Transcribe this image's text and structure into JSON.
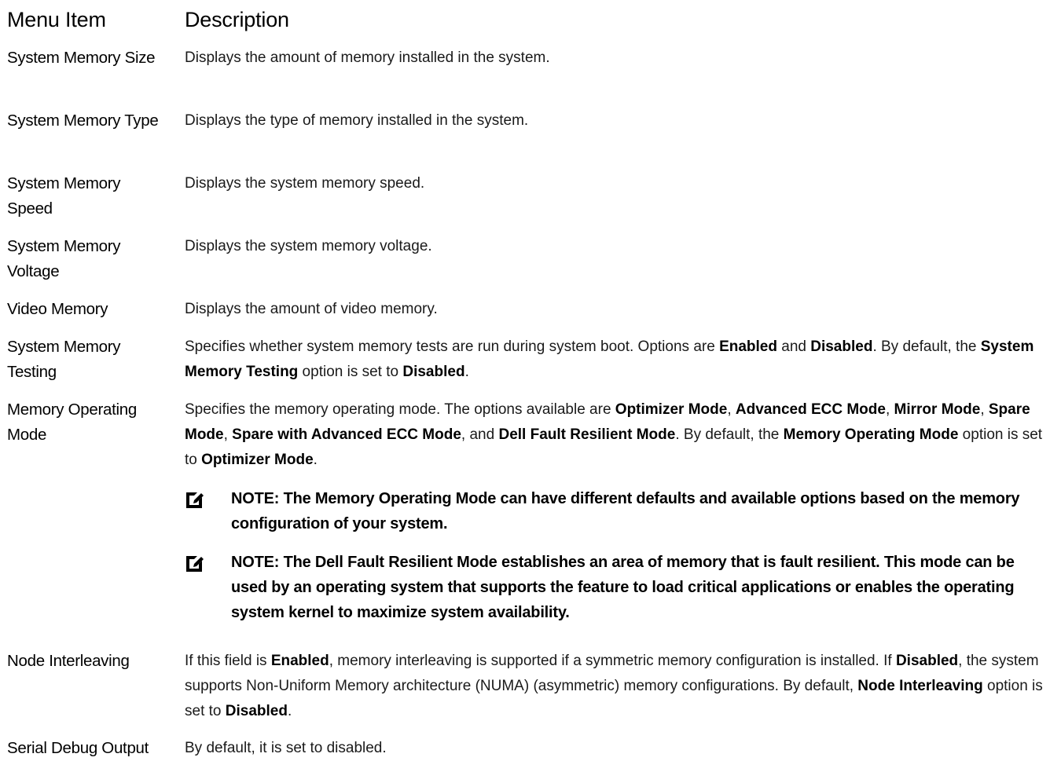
{
  "header": {
    "col_item": "Menu Item",
    "col_desc": "Description"
  },
  "rows": [
    {
      "item": "System Memory Size",
      "desc": "Displays the amount of memory installed in the system."
    },
    {
      "item": "System Memory Type",
      "desc": "Displays the type of memory installed in the system."
    },
    {
      "item": "System Memory Speed",
      "desc": "Displays the system memory speed."
    },
    {
      "item": "System Memory Voltage",
      "desc": "Displays the system memory voltage."
    },
    {
      "item": "Video Memory",
      "desc": "Displays the amount of video memory."
    },
    {
      "item": "System Memory Testing",
      "desc": "Specifies whether system memory tests are run during system boot. Options are **Enabled** and **Disabled**. By default, the **System Memory Testing** option is set to **Disabled**."
    },
    {
      "item": "Memory Operating Mode",
      "desc": "Specifies the memory operating mode. The options available are **Optimizer Mode**, **Advanced ECC Mode**, **Mirror Mode**, **Spare Mode**, **Spare with Advanced ECC Mode**, and **Dell Fault Resilient Mode**. By default, the **Memory Operating Mode** option is set to **Optimizer Mode**."
    },
    {
      "item": "Node Interleaving",
      "desc": "If this field is **Enabled**, memory interleaving is supported if a symmetric memory configuration is installed. If **Disabled**, the system supports Non-Uniform Memory architecture (NUMA) (asymmetric) memory configurations. By default, **Node Interleaving** option is set to **Disabled**."
    },
    {
      "item": "Serial Debug Output",
      "desc": "By default, it is set to disabled."
    }
  ],
  "notes": [
    {
      "icon": "note-pencil-icon",
      "text": "NOTE: The Memory Operating Mode can have different defaults and available options based on the memory configuration of your system."
    },
    {
      "icon": "note-pencil-icon",
      "text": "NOTE: The Dell Fault Resilient Mode establishes an area of memory that is fault resilient. This mode can be used by an operating system that supports the feature to load critical applications or enables the operating system kernel to maximize system availability."
    }
  ]
}
